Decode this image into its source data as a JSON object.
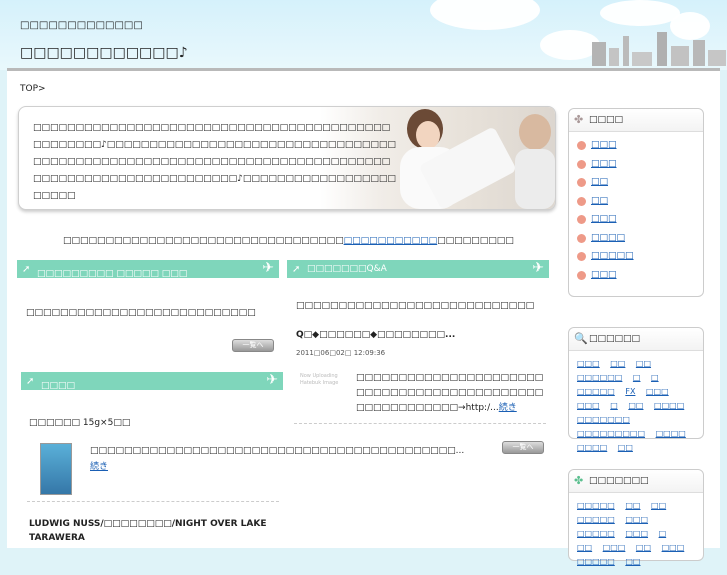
{
  "header": {
    "tagline": "□□□□□□□□□□□□□",
    "site_title": "□□□□□□□□□□□□♪"
  },
  "breadcrumb": "TOP>",
  "hero": {
    "text": "□□□□□□□□□□□□□□□□□□□□□□□□□□□□□□□□□□□□□□□□□□□□□□□□□□♪□□□□□□□□□□□□□□□□□□□□□□□□□□□□□□□□□□□□□□□□□□□□□□□□□□□□□□□□□□□□□□□□□□□□□□□□□□□□□□□□□□□□□□□□□□□□□□□□□□□□♪□□□□□□□□□□□□□□□□□□□□□□□"
  },
  "intro": {
    "before": "□□□□□□□□□□□□□□□□□□□□□□□□□□□□□□□□□",
    "link": "□□□□□□□□□□□",
    "after": "□□□□□□□□□"
  },
  "left_section": {
    "title": "□□□□□□□□□ □□□□□ □□□",
    "text": "□□□□□□□□□□□□□□□□□□□□□□□□□□□",
    "more_label": "一覧へ"
  },
  "right_section": {
    "title": "□□□□□□□Q&A",
    "intro": "□□□□□□□□□□□□□□□□□□□□□□□□□□□□",
    "post_title": "Q□◆□□□□□□◆□□□□□□□□...",
    "post_date": "2011□06□02□ 12:09:36",
    "thumb_caption": "Now Uploading Hatebuk Image",
    "post_excerpt": "□□□□□□□□□□□□□□□□□□□□□□□□□□□□□□□□□□□□□□□□□□□□□□□□□□□□□□□□→http:/...",
    "post_more": "続き",
    "more_label": "一覧へ"
  },
  "product_section": {
    "title": "□□□□",
    "item1_title": "□□□□□□ 15g×5□□",
    "item1_desc": "□□□□□□□□□□□□□□□□□□□□□□□□□□□□□□□□□□□□□□□□□□□...",
    "item1_more": "続き",
    "item2_title": "LUDWIG NUSS/□□□□□□□□/NIGHT OVER LAKE TARAWERA"
  },
  "sidebar": {
    "menu_title": "□□□□",
    "menu_items": [
      "□□□",
      "□□□",
      "□□",
      "□□",
      "□□□",
      "□□□□",
      "□□□□□",
      "□□□"
    ],
    "search_title": "□□□□□□",
    "search_tags": [
      "□□□",
      "□□",
      "□□",
      "□□□□□□",
      "□",
      "□",
      "□□□□□",
      "FX",
      "□□□",
      "□□□",
      "□",
      "□□",
      "□□□□",
      "□□□□□□□",
      "□□□□□□□□□",
      "□□□□",
      "□□□□",
      "□□"
    ],
    "links_title": "□□□□□□□",
    "link_tags": [
      "□□□□□",
      "□□",
      "□□",
      "□□□□□",
      "□□□",
      "□□□□□",
      "□□□",
      "□",
      "□□",
      "□□□",
      "□□",
      "□□□",
      "□□□□□",
      "□□"
    ]
  },
  "colors": {
    "accent_green": "#7fd6bb",
    "link_blue": "#1a5fb4",
    "bullet_pink": "#ee9a88"
  }
}
